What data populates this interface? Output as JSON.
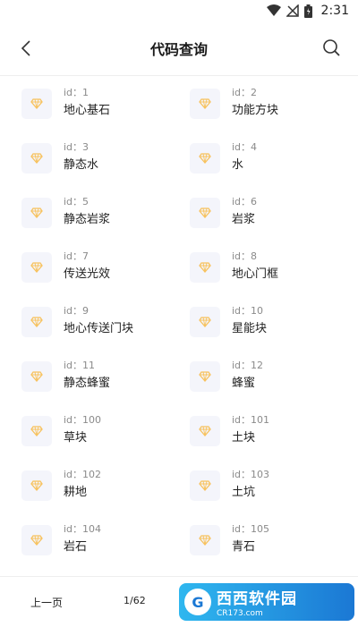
{
  "status": {
    "time": "2:31"
  },
  "header": {
    "title": "代码查询"
  },
  "grid": {
    "items": [
      {
        "id": "id：1",
        "name": "地心基石"
      },
      {
        "id": "id：2",
        "name": "功能方块"
      },
      {
        "id": "id：3",
        "name": "静态水"
      },
      {
        "id": "id：4",
        "name": "水"
      },
      {
        "id": "id：5",
        "name": "静态岩浆"
      },
      {
        "id": "id：6",
        "name": "岩浆"
      },
      {
        "id": "id：7",
        "name": "传送光效"
      },
      {
        "id": "id：8",
        "name": "地心门框"
      },
      {
        "id": "id：9",
        "name": "地心传送门块"
      },
      {
        "id": "id：10",
        "name": "星能块"
      },
      {
        "id": "id：11",
        "name": "静态蜂蜜"
      },
      {
        "id": "id：12",
        "name": "蜂蜜"
      },
      {
        "id": "id：100",
        "name": "草块"
      },
      {
        "id": "id：101",
        "name": "土块"
      },
      {
        "id": "id：102",
        "name": "耕地"
      },
      {
        "id": "id：103",
        "name": "土坑"
      },
      {
        "id": "id：104",
        "name": "岩石"
      },
      {
        "id": "id：105",
        "name": "青石"
      }
    ]
  },
  "footer": {
    "prev_label": "上一页",
    "page_indicator": "1/62"
  },
  "watermark": {
    "title": "西西软件园",
    "url": "CR173.com"
  },
  "colors": {
    "gem": "#f7c25e",
    "tile": "#f4f5fb",
    "watermark": "#1b78d4"
  },
  "icons": {
    "back": "chevron-left-icon",
    "search": "search-icon",
    "gem": "diamond-icon"
  }
}
